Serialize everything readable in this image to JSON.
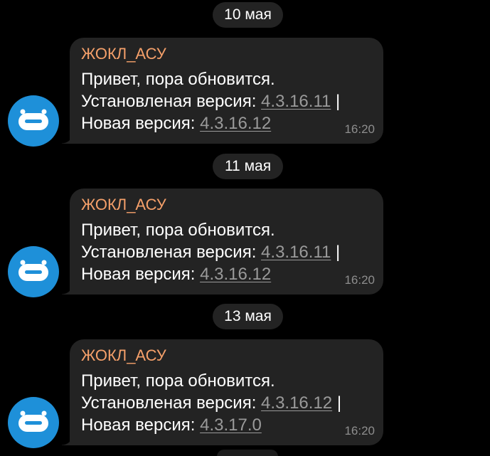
{
  "messages": [
    {
      "date": "10 мая",
      "sender": "ЖОКЛ_АСУ",
      "greeting": "Привет, пора обновится.",
      "installed_label": "Установленая версия:",
      "installed_version": "4.3.16.11",
      "separator": "|",
      "new_label": "Новая версия:",
      "new_version": "4.3.16.12",
      "time": "16:20"
    },
    {
      "date": "11 мая",
      "sender": "ЖОКЛ_АСУ",
      "greeting": "Привет, пора обновится.",
      "installed_label": "Установленая версия:",
      "installed_version": "4.3.16.11",
      "separator": "|",
      "new_label": "Новая версия:",
      "new_version": "4.3.16.12",
      "time": "16:20"
    },
    {
      "date": "13 мая",
      "sender": "ЖОКЛ_АСУ",
      "greeting": "Привет, пора обновится.",
      "installed_label": "Установленая версия:",
      "installed_version": "4.3.16.12",
      "separator": "|",
      "new_label": "Новая версия:",
      "new_version": "4.3.17.0",
      "time": "16:20"
    }
  ],
  "colors": {
    "background": "#000000",
    "bubble": "#232323",
    "sender": "#f5a06a",
    "avatar": "#1e90d9",
    "link": "#9a9a9a",
    "time": "#8e8e8e"
  },
  "icons": {
    "avatar": "robot-icon"
  }
}
